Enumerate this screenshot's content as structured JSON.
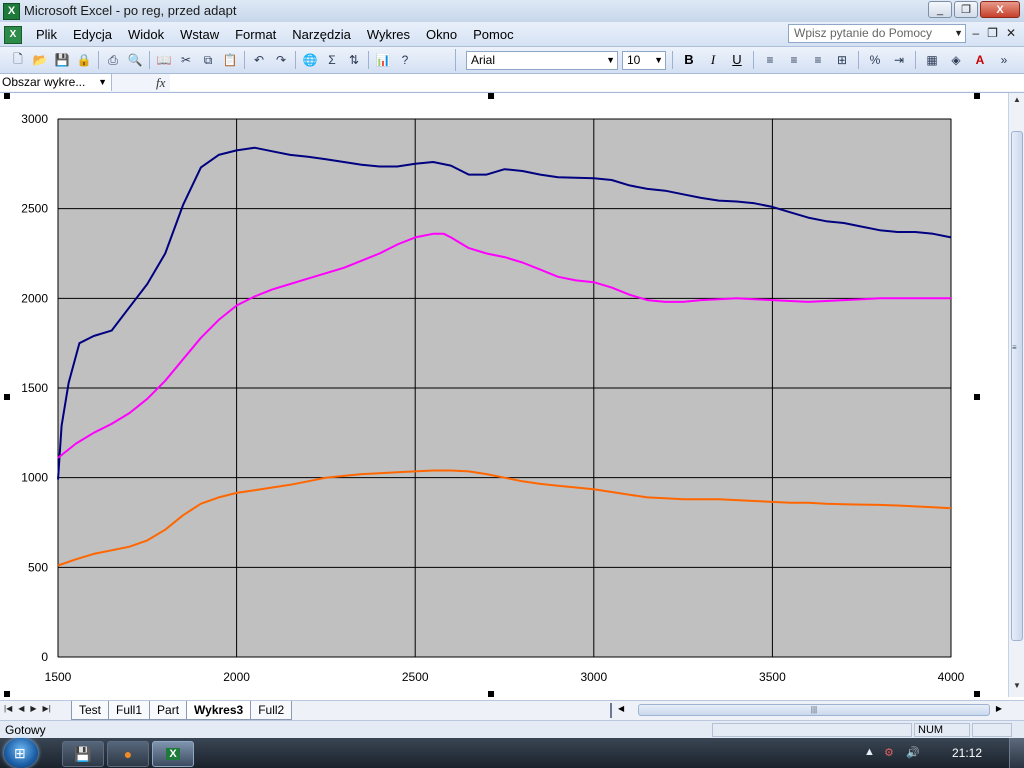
{
  "window": {
    "title": "Microsoft Excel - po reg, przed adapt",
    "app_icon": "excel-icon",
    "minimize": "_",
    "restore": "❐",
    "close": "X"
  },
  "menu": {
    "items": [
      "Plik",
      "Edycja",
      "Widok",
      "Wstaw",
      "Format",
      "Narzędzia",
      "Wykres",
      "Okno",
      "Pomoc"
    ],
    "help_placeholder": "Wpisz pytanie do Pomocy"
  },
  "toolbar": {
    "font_name": "Arial",
    "font_size": "10",
    "bold": "B",
    "italic": "I",
    "underline": "U",
    "sum": "Σ"
  },
  "formula_bar": {
    "name_box": "Obszar wykre...",
    "fx": "fx"
  },
  "chart_data": {
    "type": "line",
    "xlim": [
      1500,
      4000
    ],
    "ylim": [
      0,
      3000
    ],
    "x_ticks": [
      "1500",
      "2000",
      "2500",
      "3000",
      "3500",
      "4000"
    ],
    "y_ticks": [
      "0",
      "500",
      "1000",
      "1500",
      "2000",
      "2500",
      "3000"
    ],
    "grid": true,
    "plot_background": "#c0c0c0",
    "series": [
      {
        "color": "#000080",
        "x": [
          1500,
          1510,
          1530,
          1560,
          1600,
          1650,
          1700,
          1750,
          1800,
          1850,
          1900,
          1950,
          2000,
          2050,
          2100,
          2150,
          2200,
          2250,
          2300,
          2350,
          2400,
          2450,
          2500,
          2550,
          2600,
          2650,
          2700,
          2750,
          2800,
          2850,
          2900,
          3000,
          3050,
          3100,
          3150,
          3200,
          3250,
          3300,
          3350,
          3400,
          3450,
          3500,
          3550,
          3600,
          3650,
          3700,
          3750,
          3800,
          3850,
          3900,
          3950,
          4000
        ],
        "values": [
          990,
          1290,
          1530,
          1750,
          1790,
          1820,
          1950,
          2080,
          2250,
          2520,
          2730,
          2800,
          2825,
          2840,
          2820,
          2800,
          2790,
          2775,
          2760,
          2745,
          2735,
          2735,
          2750,
          2760,
          2740,
          2690,
          2690,
          2720,
          2710,
          2690,
          2675,
          2670,
          2660,
          2630,
          2610,
          2600,
          2580,
          2560,
          2545,
          2540,
          2530,
          2510,
          2480,
          2450,
          2430,
          2420,
          2400,
          2380,
          2370,
          2370,
          2360,
          2340
        ]
      },
      {
        "color": "#ff00ff",
        "x": [
          1500,
          1550,
          1600,
          1650,
          1700,
          1750,
          1800,
          1850,
          1900,
          1950,
          2000,
          2050,
          2100,
          2150,
          2200,
          2250,
          2300,
          2350,
          2400,
          2450,
          2500,
          2550,
          2580,
          2600,
          2650,
          2700,
          2750,
          2800,
          2850,
          2900,
          2950,
          3000,
          3050,
          3100,
          3150,
          3200,
          3250,
          3300,
          3350,
          3400,
          3450,
          3500,
          3550,
          3600,
          3650,
          3700,
          3750,
          3800,
          3850,
          3900,
          3950,
          4000
        ],
        "values": [
          1110,
          1190,
          1250,
          1300,
          1360,
          1440,
          1540,
          1660,
          1780,
          1880,
          1960,
          2010,
          2050,
          2080,
          2110,
          2140,
          2170,
          2210,
          2250,
          2300,
          2340,
          2360,
          2360,
          2340,
          2280,
          2250,
          2230,
          2200,
          2160,
          2120,
          2100,
          2090,
          2060,
          2020,
          1990,
          1980,
          1980,
          1990,
          1995,
          2000,
          1995,
          1990,
          1985,
          1980,
          1985,
          1990,
          1995,
          2000,
          2000,
          2000,
          2000,
          2000
        ]
      },
      {
        "color": "#ff6600",
        "x": [
          1500,
          1550,
          1600,
          1650,
          1700,
          1750,
          1800,
          1850,
          1900,
          1950,
          2000,
          2050,
          2100,
          2150,
          2200,
          2250,
          2300,
          2350,
          2400,
          2450,
          2500,
          2550,
          2600,
          2650,
          2700,
          2750,
          2800,
          2850,
          2900,
          2950,
          3000,
          3050,
          3100,
          3150,
          3200,
          3250,
          3300,
          3350,
          3400,
          3450,
          3500,
          3550,
          3600,
          3650,
          3700,
          3750,
          3800,
          3850,
          3900,
          3950,
          4000
        ],
        "values": [
          510,
          545,
          575,
          595,
          615,
          650,
          710,
          790,
          855,
          890,
          915,
          930,
          945,
          960,
          980,
          1000,
          1010,
          1020,
          1025,
          1030,
          1035,
          1040,
          1040,
          1035,
          1020,
          1000,
          980,
          965,
          955,
          945,
          935,
          920,
          905,
          890,
          885,
          880,
          880,
          880,
          875,
          870,
          865,
          860,
          860,
          855,
          852,
          850,
          848,
          845,
          840,
          835,
          830
        ]
      }
    ]
  },
  "sheets": {
    "tabs": [
      "Test",
      "Full1",
      "Part",
      "Wykres3",
      "Full2"
    ],
    "active": "Wykres3"
  },
  "status": {
    "text": "Gotowy",
    "num": "NUM"
  },
  "taskbar": {
    "clock": "21:12"
  }
}
